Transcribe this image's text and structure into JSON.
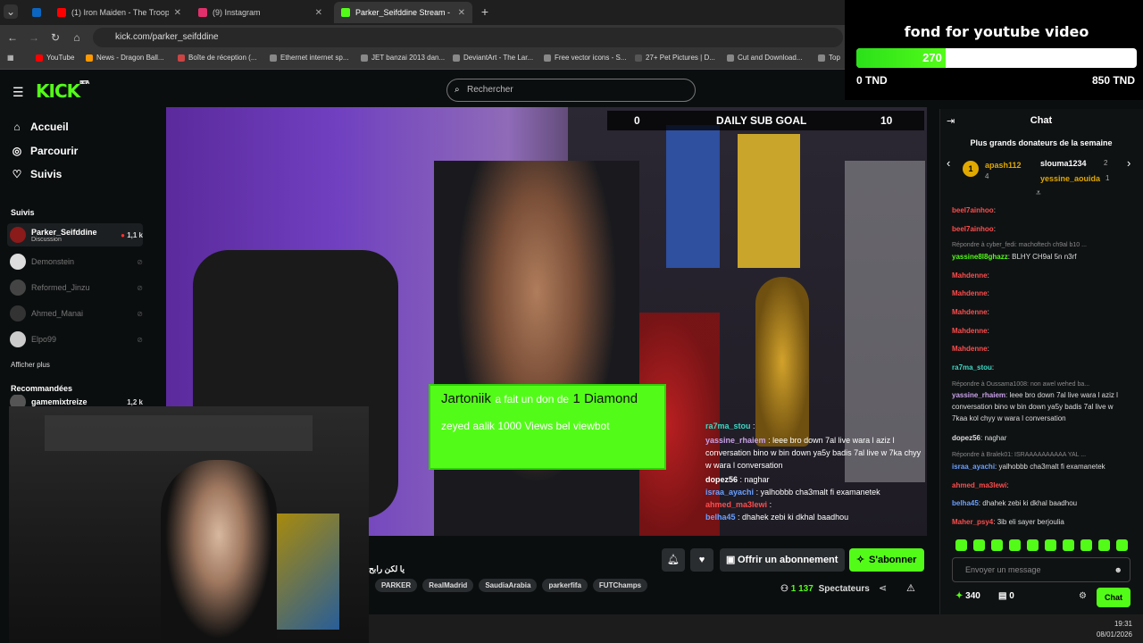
{
  "browser": {
    "tabs": [
      {
        "label": "",
        "color": "#0a66c2"
      },
      {
        "label": "(1) Iron Maiden - The Trooper",
        "color": "#ff0000"
      },
      {
        "label": "(9) Instagram",
        "color": "#e1306c"
      },
      {
        "label": "Parker_Seifddine Stream - \\",
        "color": "#53fc18"
      }
    ],
    "url": "kick.com/parker_seifddine",
    "bookmarks": [
      "YouTube",
      "News - Dragon Ball...",
      "Boîte de réception (...",
      "Ethernet internet sp...",
      "JET banzai 2013 dan...",
      "DeviantArt - The Lar...",
      "Free vector icons - S...",
      "27+ Pet Pictures | D...",
      "Cut and Download...",
      "Top"
    ]
  },
  "kick": {
    "logo": "KICK",
    "logo_badge": "BETA",
    "search_placeholder": "Rechercher"
  },
  "sidebar": {
    "nav": [
      {
        "label": "Accueil",
        "icon": "home-icon"
      },
      {
        "label": "Parcourir",
        "icon": "compass-icon"
      },
      {
        "label": "Suivis",
        "icon": "heart-icon"
      }
    ],
    "followed_heading": "Suivis",
    "followed": [
      {
        "name": "Parker_Seifddine",
        "sub": "Discussion",
        "count": "1,1 k",
        "live": true
      },
      {
        "name": "Demonstein",
        "live": false
      },
      {
        "name": "Reformed_Jinzu",
        "live": false
      },
      {
        "name": "Ahmed_Manai",
        "live": false
      },
      {
        "name": "Elpo99",
        "live": false
      }
    ],
    "show_more": "Afficher plus",
    "recommended_heading": "Recommandées",
    "recommended": [
      {
        "name": "gamemixtreize",
        "count": "1,2 k"
      }
    ]
  },
  "stream": {
    "goal": {
      "label": "DAILY SUB GOAL",
      "start": "0",
      "end": "10"
    },
    "donation": {
      "name": "Jartoniik",
      "text": "a fait un don de",
      "amount": "1 Diamond",
      "message": "zeyed aalik 1000 Views bel viewbot"
    },
    "overlay_chat": [
      {
        "user": "ra7ma_stou",
        "text": ":",
        "color": "#3dd9c4"
      },
      {
        "user": "yassine_rhaiem",
        "text": ": leee bro down 7al live wara l aziz l conversation bino w bin down ya5y badis 7al live w 7ka chyy w wara l conversation",
        "color": "#c8a2e8"
      },
      {
        "user": "dopez56",
        "text": ": naghar",
        "color": "#fff"
      },
      {
        "user": "israa_ayachi",
        "text": ": yalhobbb cha3malt fi examanetek",
        "color": "#6aa0ff"
      },
      {
        "user": "ahmed_ma3lewi",
        "text": ":",
        "color": "#ff4d4d"
      },
      {
        "user": "belha45",
        "text": ": dhahek zebi ki dkhal baadhou",
        "color": "#6aa0ff"
      }
    ]
  },
  "stream_footer": {
    "title_snippet": "يا لكن رابح",
    "tags": [
      "PARKER",
      "RealMadrid",
      "SaudiaArabia",
      "parkerfifa",
      "FUTChamps"
    ],
    "gift_label": "Offrir un abonnement",
    "subscribe_label": "S'abonner",
    "viewers_count": "1 137",
    "viewers_label": "Spectateurs"
  },
  "donation_goal": {
    "title": "fond for youtube video",
    "current": "270",
    "min_label": "0 TND",
    "max_label": "850 TND",
    "progress_fraction": 0.318,
    "fill_color": "#53fc18"
  },
  "chat": {
    "title": "Chat",
    "top_donors_heading": "Plus grands donateurs de la semaine",
    "donors": [
      {
        "rank": "1",
        "name": "apash112",
        "count": "4"
      },
      {
        "name": "slouma1234",
        "count": "2"
      },
      {
        "name": "yessine_aouida",
        "count": "1"
      }
    ],
    "messages": [
      {
        "user": "beel7ainhoo",
        "text": ":",
        "color": "#ff4d4d"
      },
      {
        "user": "beel7ainhoo",
        "text": ":",
        "color": "#ff4d4d"
      },
      {
        "reply": "Répondre à cyber_fedi: machoftech ch9al b10 ..."
      },
      {
        "user": "yassine8l8ghazz",
        "text": ": BLHY CH9al 5n n3rf",
        "color": "#53fc18"
      },
      {
        "user": "Mahdenne",
        "text": ":",
        "color": "#ff4d4d"
      },
      {
        "user": "Mahdenne",
        "text": ":",
        "color": "#ff4d4d"
      },
      {
        "user": "Mahdenne",
        "text": ":",
        "color": "#ff4d4d"
      },
      {
        "user": "Mahdenne",
        "text": ":",
        "color": "#ff4d4d"
      },
      {
        "user": "Mahdenne",
        "text": ":",
        "color": "#ff4d4d"
      },
      {
        "user": "ra7ma_stou",
        "text": ":",
        "color": "#3dd9c4"
      },
      {
        "reply": "Répondre à Oussama1008: non awel wehed ba..."
      },
      {
        "user": "yassine_rhaiem",
        "text": ": leee bro down 7al live wara l aziz l conversation bino w bin down ya5y badis 7al live w 7kaa kol chyy w wara l conversation",
        "color": "#c8a2e8"
      },
      {
        "user": "dopez56",
        "text": ": naghar",
        "color": "#fff"
      },
      {
        "reply": "Répondre à Bralek01: ISRAAAAAAAAAA YAL ..."
      },
      {
        "user": "israa_ayachi",
        "text": ": yalhobbb cha3malt fi examanetek",
        "color": "#6aa0ff"
      },
      {
        "user": "ahmed_ma3lewi",
        "text": ":",
        "color": "#ff4d4d"
      },
      {
        "user": "belha45",
        "text": ": dhahek zebi ki dkhal baadhou",
        "color": "#6aa0ff"
      },
      {
        "user": "Maher_psy4",
        "text": ": 3ib eli sayer berjoulia",
        "color": "#ff4d4d"
      }
    ],
    "input_placeholder": "Envoyer un message",
    "points": "340",
    "gifts": "0",
    "send_label": "Chat"
  },
  "taskbar": {
    "time": "19:31",
    "date": "08/01/2026"
  }
}
